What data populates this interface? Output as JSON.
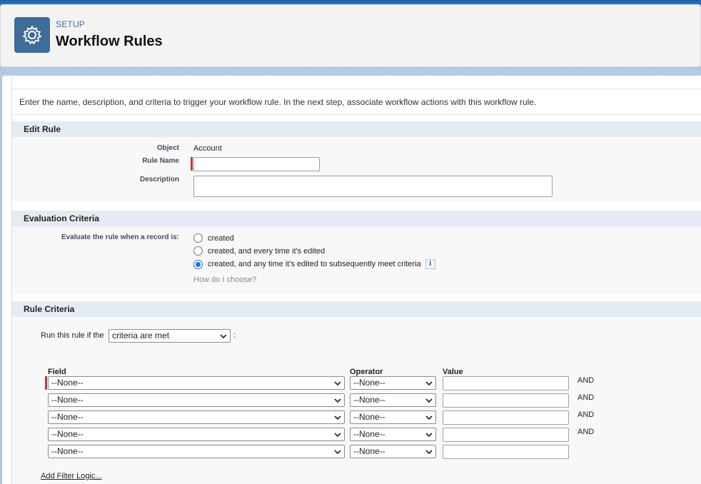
{
  "header": {
    "eyebrow": "SETUP",
    "title": "Workflow Rules",
    "icon": "gear-icon"
  },
  "intro": "Enter the name, description, and criteria to trigger your workflow rule. In the next step, associate workflow actions with this workflow rule.",
  "edit_rule": {
    "heading": "Edit Rule",
    "object_label": "Object",
    "object_value": "Account",
    "rule_name_label": "Rule Name",
    "rule_name_value": "",
    "description_label": "Description",
    "description_value": ""
  },
  "evaluation": {
    "heading": "Evaluation Criteria",
    "label": "Evaluate the rule when a record is:",
    "options": [
      {
        "label": "created",
        "checked": false
      },
      {
        "label": "created, and every time it's edited",
        "checked": false
      },
      {
        "label": "created, and any time it's edited to subsequently meet criteria",
        "checked": true
      }
    ],
    "help_link": "How do I choose?"
  },
  "rule_criteria": {
    "heading": "Rule Criteria",
    "run_prefix": "Run this rule if the",
    "run_select": "criteria are met",
    "run_suffix": ":",
    "columns": {
      "field": "Field",
      "operator": "Operator",
      "value": "Value"
    },
    "rows": [
      {
        "field": "--None--",
        "operator": "--None--",
        "value": "",
        "conj": "AND"
      },
      {
        "field": "--None--",
        "operator": "--None--",
        "value": "",
        "conj": "AND"
      },
      {
        "field": "--None--",
        "operator": "--None--",
        "value": "",
        "conj": "AND"
      },
      {
        "field": "--None--",
        "operator": "--None--",
        "value": "",
        "conj": "AND"
      },
      {
        "field": "--None--",
        "operator": "--None--",
        "value": "",
        "conj": ""
      }
    ],
    "filter_logic_link": "Add Filter Logic..."
  },
  "colors": {
    "brand": "#3e6d98",
    "required": "#c23934",
    "section_header": "#e5ebf3"
  }
}
